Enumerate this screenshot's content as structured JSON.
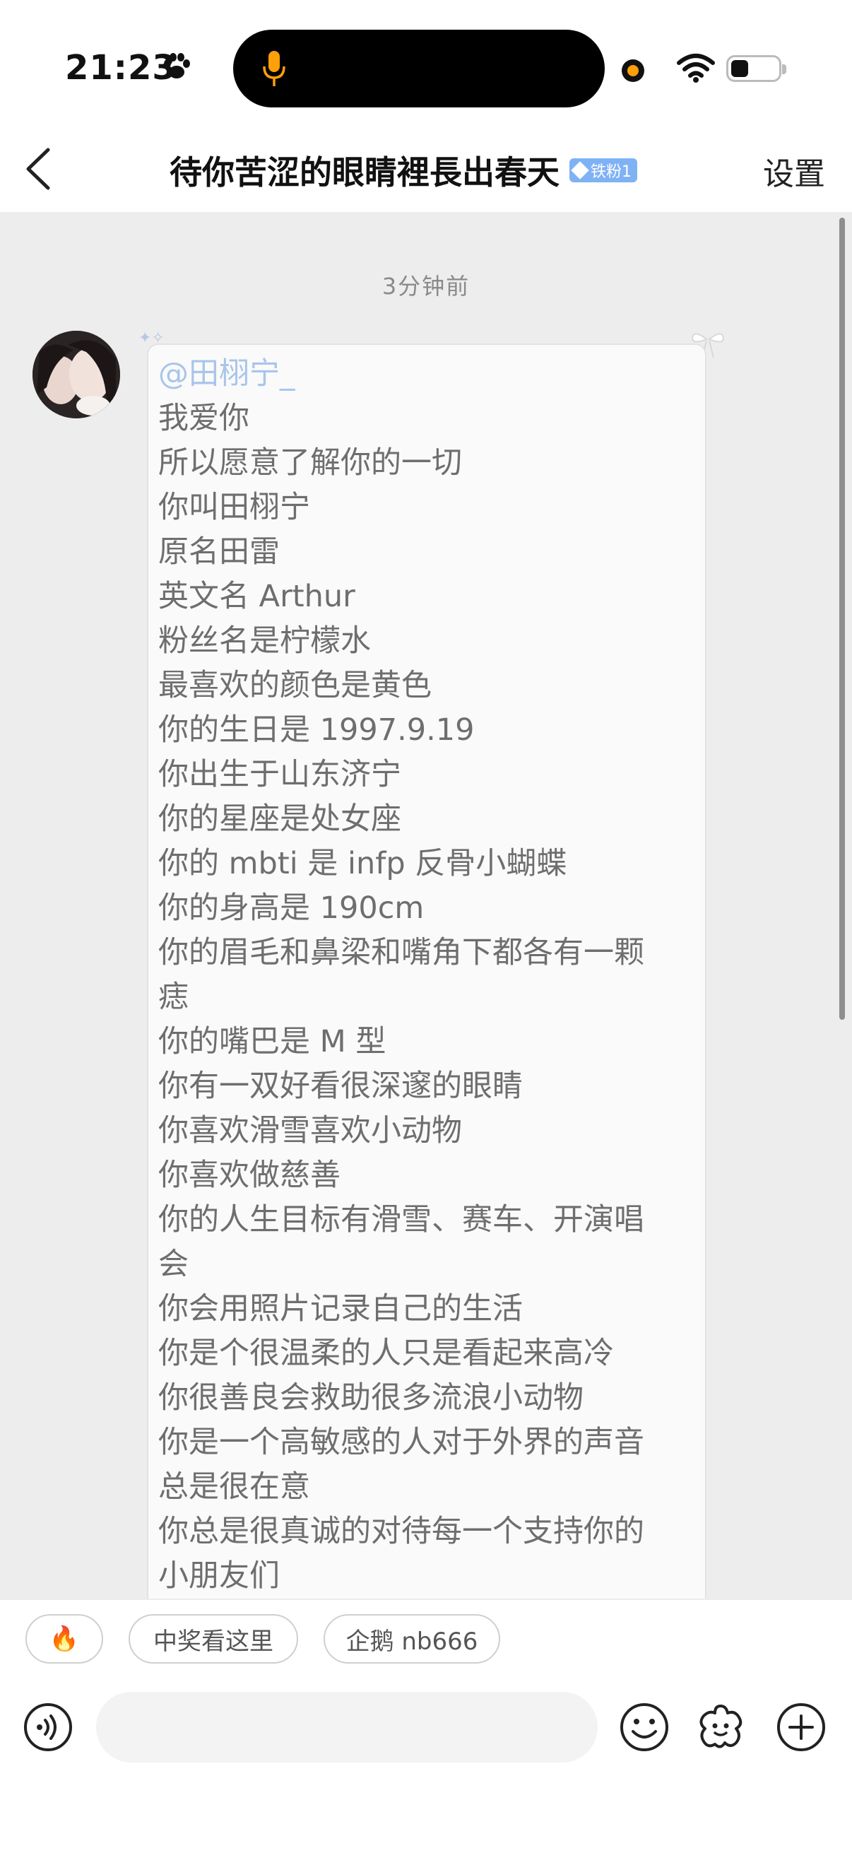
{
  "status_bar": {
    "time": "21:23"
  },
  "header": {
    "title": "待你苦涩的眼睛裡長出春天",
    "badge": "铁粉1",
    "settings_label": "设置"
  },
  "chat": {
    "timestamp": "3分钟前",
    "message": {
      "mention": "@田栩宁_",
      "lines": [
        "我爱你",
        "所以愿意了解你的一切",
        "你叫田栩宁",
        "原名田雷",
        "英文名 Arthur",
        "粉丝名是柠檬水",
        "最喜欢的颜色是黄色",
        "你的生日是 1997.9.19",
        "你出生于山东济宁",
        "你的星座是处女座",
        "你的 mbti 是 infp 反骨小蝴蝶",
        "你的身高是 190cm",
        "你的眉毛和鼻梁和嘴角下都各有一颗",
        "痣",
        "你的嘴巴是 M 型",
        "你有一双好看很深邃的眼睛",
        "你喜欢滑雪喜欢小动物",
        "你喜欢做慈善",
        "你的人生目标有滑雪、赛车、开演唱",
        "会",
        "你会用照片记录自己的生活",
        "你是个很温柔的人只是看起来高冷",
        "你很善良会救助很多流浪小动物",
        "你是一个高敏感的人对于外界的声音",
        "总是很在意",
        "你总是很真诚的对待每一个支持你的",
        "小朋友们"
      ]
    }
  },
  "quick_replies": [
    "🔥",
    "中奖看这里",
    "企鹅 nb666"
  ],
  "input_bar": {
    "placeholder": ""
  },
  "colors": {
    "badge": "#7fb2f5",
    "mention": "#a9c5ea",
    "chat_bg": "#ededed",
    "bubble_bg": "#fafafa"
  }
}
